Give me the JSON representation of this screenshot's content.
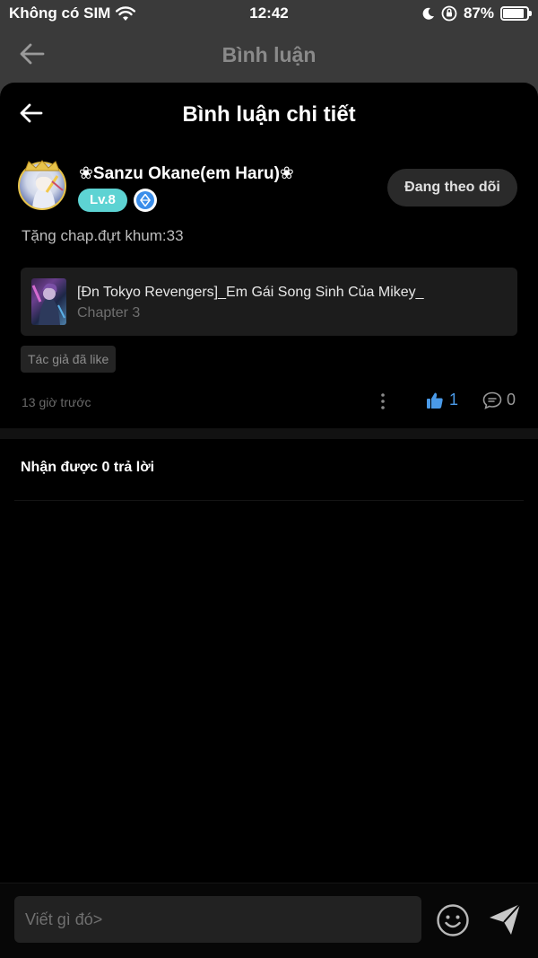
{
  "status_bar": {
    "carrier": "Không có SIM",
    "time": "12:42",
    "battery": "87%",
    "battery_level": 0.87
  },
  "background_page": {
    "title": "Bình luận"
  },
  "sheet": {
    "title": "Bình luận chi tiết"
  },
  "comment": {
    "username": "❀Sanzu Okane(em Haru)❀",
    "level": "Lv.8",
    "follow_label": "Đang theo dõi",
    "text": "Tặng chap.đựt khum:33",
    "story_title": "[Đn Tokyo Revengers]_Em Gái Song Sinh Của Mikey_",
    "story_chapter": "Chapter 3",
    "author_like": "Tác giả đã like",
    "time_ago": "13 giờ trước",
    "like_count": "1",
    "reply_count": "0"
  },
  "replies": {
    "header": "Nhận được 0 trả lời"
  },
  "input": {
    "placeholder": "Viết gì đó>"
  },
  "colors": {
    "level_badge": "#5dd3d3",
    "like_accent": "#4a9ae8",
    "vip_badge": "#3b8eea"
  }
}
